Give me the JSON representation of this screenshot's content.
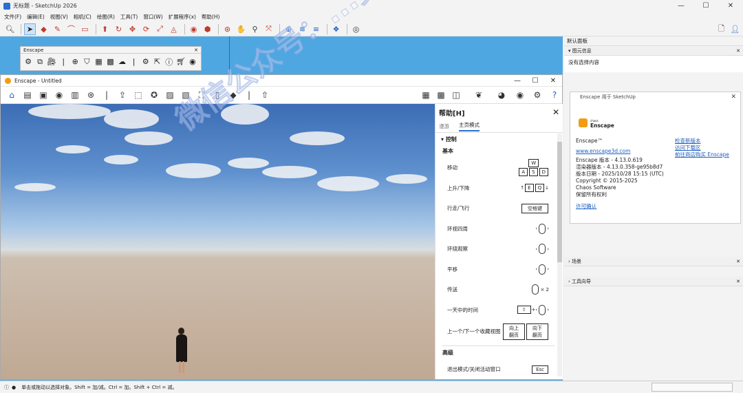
{
  "app": {
    "title": "无标题 - SketchUp 2026"
  },
  "menu": [
    "文件(F)",
    "编辑(E)",
    "视图(V)",
    "相机(C)",
    "绘图(R)",
    "工具(T)",
    "窗口(W)",
    "扩展程序(x)",
    "帮助(H)"
  ],
  "enscape_panel": {
    "title": "Enscape"
  },
  "enscape_window": {
    "title": "Enscape - Untitled"
  },
  "help": {
    "title": "帮助[H]",
    "tabs": [
      "漫游",
      "主页模式"
    ],
    "section_control": "控制",
    "section_basic": "基本",
    "rows": [
      {
        "label": "移动",
        "keys": "W A S D"
      },
      {
        "label": "上升/下降",
        "keys": "E Q"
      },
      {
        "label": "行走/飞行",
        "keys": "空格键"
      },
      {
        "label": "环视四周",
        "keys": ""
      },
      {
        "label": "环绕观察",
        "keys": ""
      },
      {
        "label": "平移",
        "keys": ""
      },
      {
        "label": "传送",
        "keys": "× 2"
      },
      {
        "label": "一天中的时间",
        "keys": "+"
      },
      {
        "label": "上一个/下一个收藏视图",
        "keys": "向上翻页 向下翻页"
      }
    ],
    "section_advanced": "高级",
    "advanced_row": {
      "label": "退出模式/关闭活动窗口",
      "key": "Esc"
    }
  },
  "right_panel": {
    "title": "默认面板",
    "entity_info": "图元信息",
    "no_selection": "没有选择内容",
    "scenes": "场景",
    "instructor": "工具向导"
  },
  "about": {
    "title": "Enscape 用于 SketchUp",
    "brand_small": "chaos",
    "brand": "Enscape",
    "product": "Enscape™",
    "website": "www.enscape3d.com",
    "version": "Enscape 版本 - 4.13.0.619",
    "renderer": "渲染器版本 - 4.13.0.358-ge95b8d7",
    "date": "版本日期 - 2025/10/28 15:15 (UTC)",
    "copyright": "Copyright © 2015-2025",
    "company": "Chaos Software",
    "rights": "保留所有权利",
    "license": "许可确认",
    "links": [
      "检查新版本",
      "访问下载区",
      "前往商店购买 Enscape"
    ]
  },
  "status": {
    "text": "单击或拖动以选择对象。Shift = 加/减。Ctrl = 加。Shift + Ctrl = 减。"
  },
  "watermark": "微信公众号：...资源站"
}
